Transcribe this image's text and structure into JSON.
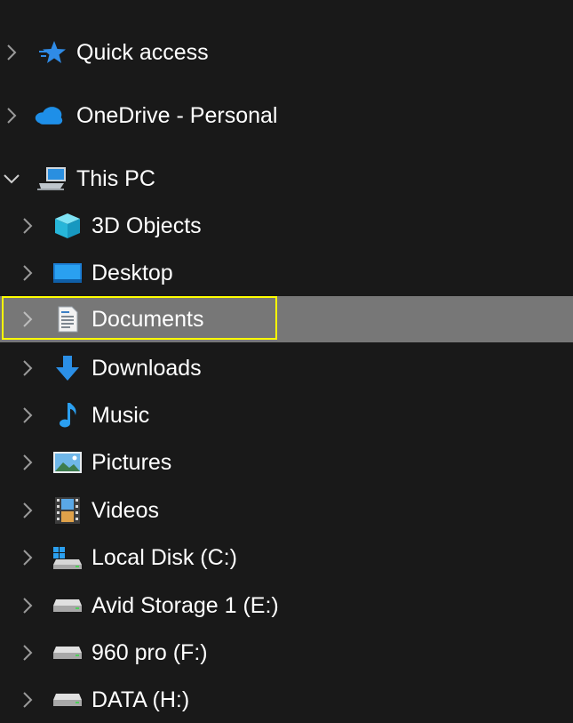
{
  "nav": {
    "quick_access": "Quick access",
    "onedrive": "OneDrive - Personal",
    "this_pc": "This PC",
    "items": [
      {
        "label": "3D Objects",
        "icon": "3d-objects-icon"
      },
      {
        "label": "Desktop",
        "icon": "desktop-icon"
      },
      {
        "label": "Documents",
        "icon": "documents-icon",
        "selected": true
      },
      {
        "label": "Downloads",
        "icon": "downloads-icon"
      },
      {
        "label": "Music",
        "icon": "music-icon"
      },
      {
        "label": "Pictures",
        "icon": "pictures-icon"
      },
      {
        "label": "Videos",
        "icon": "videos-icon"
      },
      {
        "label": "Local Disk (C:)",
        "icon": "windows-drive-icon"
      },
      {
        "label": "Avid Storage 1 (E:)",
        "icon": "drive-icon"
      },
      {
        "label": "960 pro (F:)",
        "icon": "drive-icon"
      },
      {
        "label": "DATA (H:)",
        "icon": "drive-icon"
      }
    ]
  },
  "colors": {
    "background": "#191919",
    "selected_row": "#777777",
    "highlight_box": "#ffff00",
    "accent_blue": "#1e90ff"
  }
}
